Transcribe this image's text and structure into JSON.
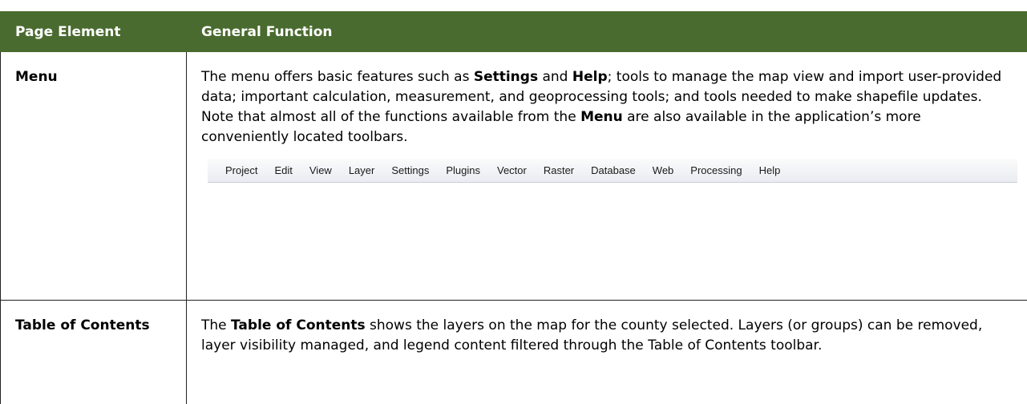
{
  "table": {
    "headers": [
      "Page Element",
      "General Function"
    ],
    "rows": [
      {
        "element": "Menu",
        "p": [
          "The menu offers basic features such as ",
          "Settings",
          " and ",
          "Help",
          "; tools to manage the map view and import user-provided data; important calculation, measurement, and geoprocessing tools; and tools needed to make shapefile updates. Note that almost all of the functions available from the ",
          "Menu",
          " are also available in the application’s more conveniently located toolbars."
        ],
        "menubar_items": [
          "Project",
          "Edit",
          "View",
          "Layer",
          "Settings",
          "Plugins",
          "Vector",
          "Raster",
          "Database",
          "Web",
          "Processing",
          "Help"
        ]
      },
      {
        "element": "Table of Contents",
        "p": [
          "The ",
          "Table of Contents",
          " shows the layers on the map for the county selected. Layers (or groups) can be removed, layer visibility managed, and legend content filtered through the Table of Contents toolbar."
        ]
      }
    ]
  }
}
